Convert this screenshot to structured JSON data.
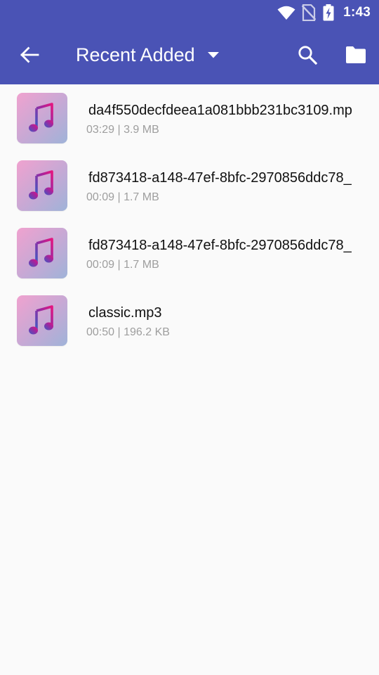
{
  "status_bar": {
    "time": "1:43",
    "icons": [
      "wifi-icon",
      "no-sim-icon",
      "battery-charging-icon"
    ]
  },
  "app_bar": {
    "title": "Recent Added",
    "icons": [
      "arrow-back-icon",
      "dropdown-arrow-icon",
      "search-icon",
      "folder-icon"
    ],
    "background_color": "#4a53b5"
  },
  "files": [
    {
      "name": "da4f550decfdeea1a081bbb231bc3109.mp",
      "duration": "03:29",
      "size": "3.9 MB",
      "meta": "03:29 | 3.9 MB",
      "icon": "music-note-icon"
    },
    {
      "name": "fd873418-a148-47ef-8bfc-2970856ddc78_",
      "duration": "00:09",
      "size": "1.7 MB",
      "meta": "00:09 | 1.7 MB",
      "icon": "music-note-icon"
    },
    {
      "name": "fd873418-a148-47ef-8bfc-2970856ddc78_",
      "duration": "00:09",
      "size": "1.7 MB",
      "meta": "00:09 | 1.7 MB",
      "icon": "music-note-icon"
    },
    {
      "name": "classic.mp3",
      "duration": "00:50",
      "size": "196.2 KB",
      "meta": "00:50 | 196.2 KB",
      "icon": "music-note-icon"
    }
  ]
}
